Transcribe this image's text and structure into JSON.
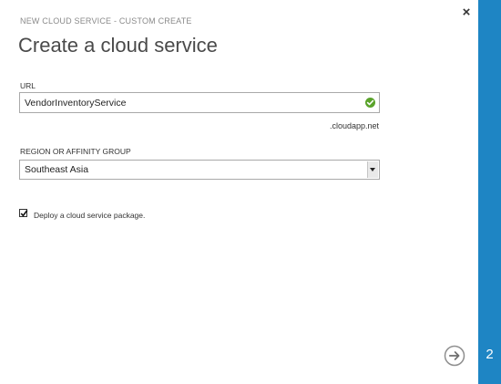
{
  "dialog": {
    "subtitle": "NEW CLOUD SERVICE - CUSTOM CREATE",
    "title": "Create a cloud service",
    "close_glyph": "×"
  },
  "url": {
    "label": "URL",
    "value": "VendorInventoryService",
    "suffix": ".cloudapp.net",
    "valid_icon": "check-circle-icon",
    "valid_color": "#5aa32b"
  },
  "region": {
    "label": "REGION OR AFFINITY GROUP",
    "selected": "Southeast Asia"
  },
  "deploy": {
    "checked": true,
    "label": "Deploy a cloud service package."
  },
  "footer": {
    "next_icon": "arrow-right-circle-icon",
    "step": "2"
  },
  "colors": {
    "accent": "#1e85c4"
  }
}
